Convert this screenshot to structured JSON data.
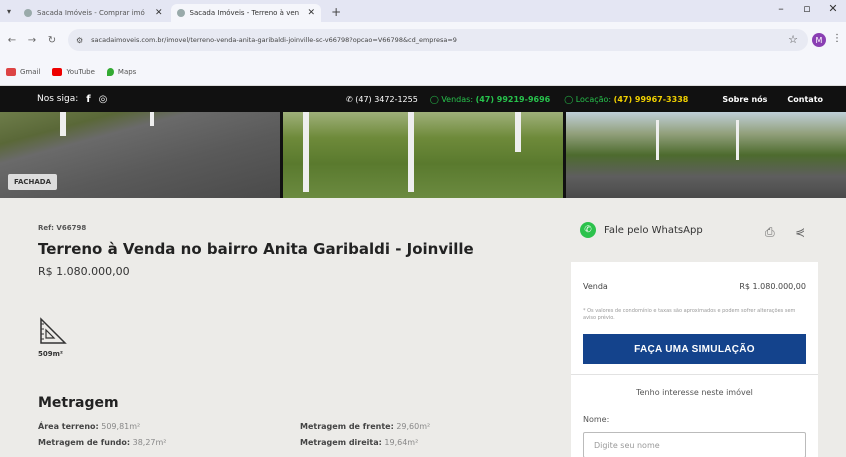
{
  "browser": {
    "tabs": [
      {
        "label": "Sacada Imóveis - Comprar imó",
        "active": false
      },
      {
        "label": "Sacada Imóveis - Terreno à ven",
        "active": true
      }
    ],
    "url": "sacadaimoveis.com.br/imovel/terreno-venda-anita-garibaldi-joinville-sc-v66798?opcao=V66798&cd_empresa=9",
    "profile_initial": "M",
    "bookmarks": [
      "Gmail",
      "YouTube",
      "Maps"
    ]
  },
  "site": {
    "follow_label": "Nos siga:",
    "phone": "(47) 3472-1255",
    "vendas_label": "Vendas:",
    "vendas_phone": "(47) 99219-9696",
    "locacao_label": "Locação:",
    "locacao_phone": "(47) 99967-3338",
    "about": "Sobre nós",
    "contact": "Contato"
  },
  "gallery": {
    "badge": "FACHADA"
  },
  "listing": {
    "ref": "Ref: V66798",
    "title": "Terreno à Venda no bairro Anita Garibaldi - Joinville",
    "price": "R$ 1.080.000,00",
    "area": "509m²",
    "section_title": "Metragem",
    "specs": [
      {
        "label": "Área terreno:",
        "value": "509,81m²"
      },
      {
        "label": "Metragem de frente:",
        "value": "29,60m²"
      },
      {
        "label": "Metragem de fundo:",
        "value": "38,27m²"
      },
      {
        "label": "Metragem direita:",
        "value": "19,64m²"
      }
    ]
  },
  "sidebar": {
    "whatsapp": "Fale pelo WhatsApp",
    "venda_label": "Venda",
    "venda_value": "R$ 1.080.000,00",
    "note": "* Os valores de condomínio e taxas são aproximados e podem sofrer alterações sem aviso prévio.",
    "simulate_button": "FAÇA UMA SIMULAÇÃO",
    "interest": "Tenho interesse neste imóvel",
    "name_label": "Nome:",
    "name_placeholder": "Digite seu nome"
  },
  "colors": {
    "brand_blue": "#14438c",
    "whatsapp_green": "#2cc24c",
    "topbar": "#111111"
  }
}
